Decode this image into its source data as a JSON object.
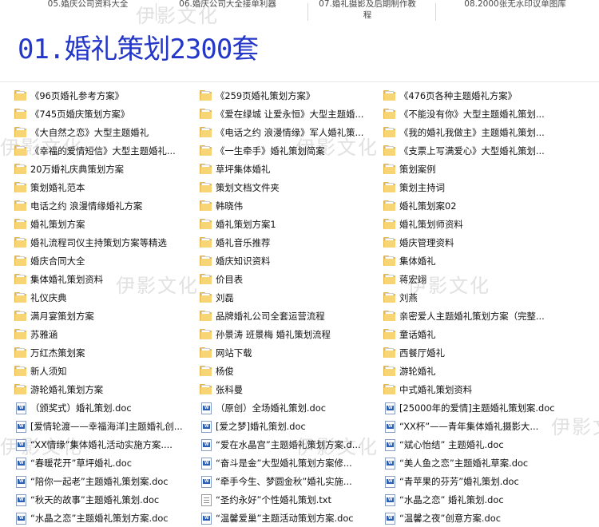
{
  "top_tabs": [
    "05.婚庆公司资料大全",
    "06.婚庆公司大全接单利器",
    "07.婚礼摄影及后期制作教程",
    "08.2000张无水印议单图库"
  ],
  "heading": "01.婚礼策划2300套",
  "watermark": "伊影文化",
  "columns": [
    [
      {
        "icon": "folder",
        "label": "《96页婚礼参考方案》"
      },
      {
        "icon": "folder",
        "label": "《745页婚庆策划方案》"
      },
      {
        "icon": "folder",
        "label": "《大自然之恋》大型主题婚礼"
      },
      {
        "icon": "folder",
        "label": "《幸福的爱情短信》大型主题婚礼..."
      },
      {
        "icon": "folder",
        "label": "20万婚礼庆典策划方案"
      },
      {
        "icon": "folder",
        "label": "策划婚礼范本"
      },
      {
        "icon": "folder-open",
        "label": "电话之约 浪漫情缘婚礼方案"
      },
      {
        "icon": "folder",
        "label": "婚礼策划方案"
      },
      {
        "icon": "folder",
        "label": "婚礼流程司仪主持策划方案等精选"
      },
      {
        "icon": "folder",
        "label": "婚庆合同大全"
      },
      {
        "icon": "folder",
        "label": "集体婚礼策划资料"
      },
      {
        "icon": "folder",
        "label": "礼仪庆典"
      },
      {
        "icon": "folder",
        "label": "满月宴策划方案"
      },
      {
        "icon": "folder",
        "label": "苏雅涵"
      },
      {
        "icon": "folder",
        "label": "万红杰策划案"
      },
      {
        "icon": "folder",
        "label": "新人须知"
      },
      {
        "icon": "folder",
        "label": "游轮婚礼策划方案"
      },
      {
        "icon": "doc",
        "label": "（颁奖式）婚礼策划.doc"
      },
      {
        "icon": "doc",
        "label": "[爱情轮渡——幸福海洋]主题婚礼创..."
      },
      {
        "icon": "doc",
        "label": "“XX情缘”集体婚礼活动实施方案...."
      },
      {
        "icon": "doc",
        "label": "“春暖花开”草坪婚礼.doc"
      },
      {
        "icon": "doc",
        "label": "“陪你一起老”主题婚礼策划案.doc"
      },
      {
        "icon": "doc",
        "label": "“秋天的故事”主题婚礼策划.doc"
      },
      {
        "icon": "doc",
        "label": "“水晶之恋”主题婚礼策划方案.doc"
      }
    ],
    [
      {
        "icon": "folder",
        "label": "《259页婚礼策划方案》"
      },
      {
        "icon": "folder",
        "label": "《爱在绿城 让爱永恒》大型主题婚..."
      },
      {
        "icon": "folder",
        "label": "《电话之约 浪漫情缘》军人婚礼策..."
      },
      {
        "icon": "folder",
        "label": "《一生牵手》婚礼策划简案"
      },
      {
        "icon": "folder",
        "label": "草坪集体婚礼"
      },
      {
        "icon": "folder",
        "label": "策划文档文件夹"
      },
      {
        "icon": "folder",
        "label": "韩晓伟"
      },
      {
        "icon": "folder",
        "label": "婚礼策划方案1"
      },
      {
        "icon": "folder",
        "label": "婚礼音乐推荐"
      },
      {
        "icon": "folder",
        "label": "婚庆知识资料"
      },
      {
        "icon": "folder",
        "label": "价目表"
      },
      {
        "icon": "folder",
        "label": "刘磊"
      },
      {
        "icon": "folder",
        "label": "品牌婚礼公司全套运营流程"
      },
      {
        "icon": "folder",
        "label": "孙景涛 班景梅 婚礼策划流程"
      },
      {
        "icon": "folder",
        "label": "网站下载"
      },
      {
        "icon": "folder",
        "label": "杨俊"
      },
      {
        "icon": "folder",
        "label": "张科曼"
      },
      {
        "icon": "doc",
        "label": "（原创）全场婚礼策划.doc"
      },
      {
        "icon": "doc",
        "label": "[爱之梦]婚礼策划.doc"
      },
      {
        "icon": "doc",
        "label": "“爱在水晶宫”主题婚礼策划方案.d..."
      },
      {
        "icon": "doc",
        "label": "“奋斗是金”大型婚礼策划方案修..."
      },
      {
        "icon": "doc",
        "label": "“牵手今生、梦圆金秋”婚礼实施..."
      },
      {
        "icon": "txt",
        "label": "“圣约永好”个性婚礼策划.txt"
      },
      {
        "icon": "doc",
        "label": "“温馨爱巢”主题活动策划方案.doc"
      }
    ],
    [
      {
        "icon": "folder",
        "label": "《476页各种主题婚礼方案》"
      },
      {
        "icon": "folder",
        "label": "《不能没有你》大型主题婚礼策划..."
      },
      {
        "icon": "folder",
        "label": "《我的婚礼我做主》主题婚礼策划..."
      },
      {
        "icon": "folder",
        "label": "《支票上写满爱心》大型婚礼策划..."
      },
      {
        "icon": "folder",
        "label": "策划案例"
      },
      {
        "icon": "folder",
        "label": "策划主持词"
      },
      {
        "icon": "folder",
        "label": "婚礼策划案02"
      },
      {
        "icon": "folder",
        "label": "婚礼策划师资料"
      },
      {
        "icon": "folder",
        "label": "婚庆管理资料"
      },
      {
        "icon": "folder",
        "label": "集体婚礼"
      },
      {
        "icon": "folder",
        "label": "蒋宏翊"
      },
      {
        "icon": "folder",
        "label": "刘燕"
      },
      {
        "icon": "folder",
        "label": "亲密爱人主题婚礼策划方案（完整..."
      },
      {
        "icon": "folder",
        "label": "童话婚礼"
      },
      {
        "icon": "folder",
        "label": "西餐厅婚礼"
      },
      {
        "icon": "folder",
        "label": "游轮婚礼"
      },
      {
        "icon": "folder",
        "label": "中式婚礼策划资料"
      },
      {
        "icon": "doc",
        "label": "[25000年的爱情]主题婚礼策划案.doc"
      },
      {
        "icon": "doc",
        "label": "“XX杯”——青年集体婚礼摄影大..."
      },
      {
        "icon": "doc",
        "label": "“斌心怡结” 主题婚礼.doc"
      },
      {
        "icon": "doc",
        "label": "“美人鱼之恋”主题婚礼草案.doc"
      },
      {
        "icon": "doc",
        "label": "“青苹果的芬芳”婚礼策划.doc"
      },
      {
        "icon": "doc",
        "label": "“水晶之恋” 婚礼策划.doc"
      },
      {
        "icon": "doc",
        "label": "“温馨之夜”创意方案.doc"
      }
    ]
  ]
}
